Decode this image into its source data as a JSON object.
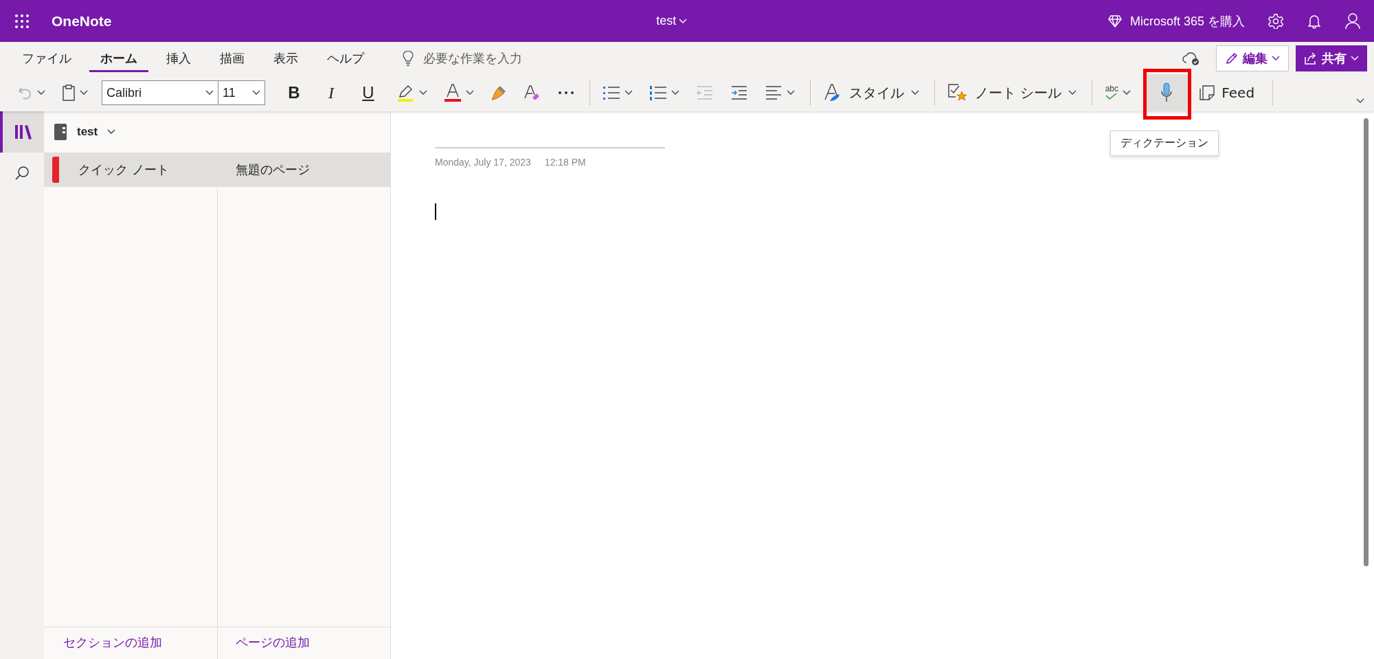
{
  "header": {
    "app_name": "OneNote",
    "notebook_title": "test",
    "buy_label": "Microsoft 365 を購入"
  },
  "ribbon": {
    "tabs": [
      {
        "label": "ファイル",
        "selected": false
      },
      {
        "label": "ホーム",
        "selected": true
      },
      {
        "label": "挿入",
        "selected": false
      },
      {
        "label": "描画",
        "selected": false
      },
      {
        "label": "表示",
        "selected": false
      },
      {
        "label": "ヘルプ",
        "selected": false
      }
    ],
    "tell_me": {
      "placeholder": "必要な作業を入力"
    },
    "edit_button": "編集",
    "share_button": "共有",
    "toolbar": {
      "font": "Calibri",
      "size": "11",
      "bold": "B",
      "italic": "I",
      "underline": "U",
      "style_label": "スタイル",
      "tags_label": "ノート シール",
      "feed_label": "Feed",
      "spelling_label": "abc",
      "dictation_highlighted": true
    },
    "tooltip": "ディクテーション"
  },
  "sidebar": {
    "notebook": "test",
    "sections": [
      {
        "label": "クイック ノート",
        "selected": true,
        "color": "#e8222a"
      }
    ],
    "pages": [
      {
        "label": "無題のページ",
        "selected": true
      }
    ],
    "add_section": "セクションの追加",
    "add_page": "ページの追加"
  },
  "page": {
    "date": "Monday, July 17, 2023",
    "time": "12:18 PM"
  }
}
